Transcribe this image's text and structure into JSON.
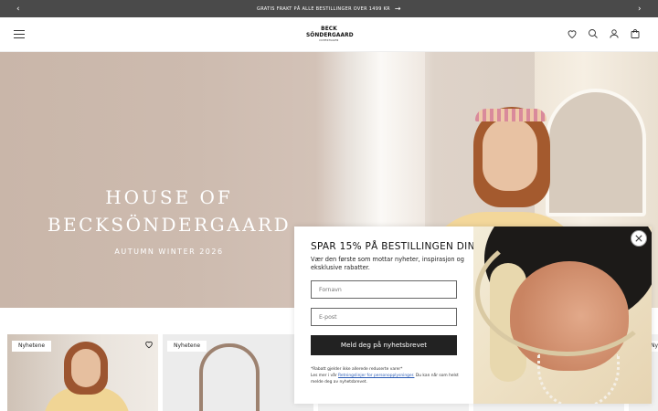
{
  "announcement": {
    "text": "GRATIS FRAKT PÅ ALLE BESTILLINGER OVER 1499 KR",
    "prev_icon": "chevron-left-icon",
    "next_icon": "chevron-right-icon",
    "link_icon": "arrow-right-icon"
  },
  "header": {
    "logo_line1": "BECK",
    "logo_line2": "SÖNDERGAARD",
    "logo_sub": "COPENHAGEN",
    "icons": [
      "menu-icon",
      "heart-icon",
      "search-icon",
      "account-icon",
      "cart-icon"
    ]
  },
  "hero": {
    "title_line1": "HOUSE OF",
    "title_line2": "BECKSÖNDERGAARD",
    "subtitle": "AUTUMN WINTER 2026"
  },
  "products": {
    "badges": [
      "Nyhetene",
      "Nyhetene",
      "Nyhetene"
    ]
  },
  "popup": {
    "title": "SPAR 15% PÅ BESTILLINGEN DIN",
    "description": "Vær den første som mottar nyheter, inspirasjon og eksklusive rabatter.",
    "first_name_placeholder": "Fornavn",
    "email_placeholder": "E-post",
    "submit_label": "Meld deg på nyhetsbrevet",
    "fine_print_1": "*Rabatt gjelder ikke allerede reduserte varer*",
    "fine_print_2_before": "Les mer i vår ",
    "fine_print_link": "Retningslinjer for personopplysninger.",
    "fine_print_2_after": " Du kan når som helst melde deg av nyhetsbrevet.",
    "close_icon": "close-icon"
  },
  "colors": {
    "announcement_bg": "#4a4a4a",
    "button_bg": "#222222",
    "link": "#2a5bb5"
  }
}
